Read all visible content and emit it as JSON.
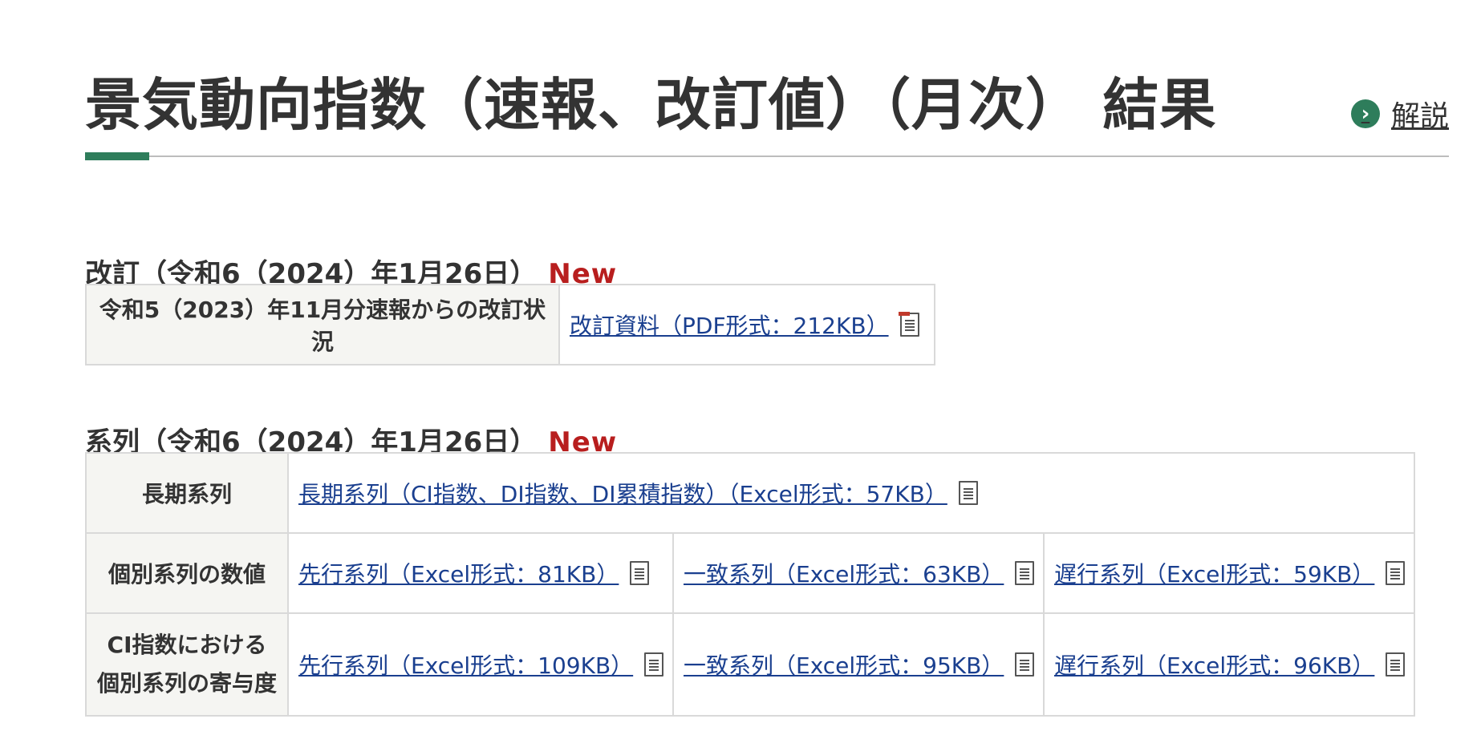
{
  "header": {
    "title": "景気動向指数（速報、改訂値）（月次） 結果",
    "explain_link": "解説",
    "colors": {
      "accent": "#2e7d5b",
      "new_badge": "#b81e1e",
      "link": "#1a3f8f"
    }
  },
  "revision_section": {
    "heading": "改訂（令和6（2024）年1月26日）",
    "new_badge": "New",
    "row_label": "令和5（2023）年11月分速報からの改訂状況",
    "link": "改訂資料（PDF形式：212KB）",
    "link_icon": "pdf-document-icon"
  },
  "series_section": {
    "heading": "系列（令和6（2024）年1月26日）",
    "new_badge": "New",
    "rows": [
      {
        "label": "長期系列",
        "links": [
          "長期系列（CI指数、DI指数、DI累積指数）（Excel形式：57KB）"
        ]
      },
      {
        "label": "個別系列の数値",
        "links": [
          "先行系列（Excel形式：81KB）",
          "一致系列（Excel形式：63KB）",
          "遅行系列（Excel形式：59KB）"
        ]
      },
      {
        "label_line1": "CI指数における",
        "label_line2": "個別系列の寄与度",
        "links": [
          "先行系列（Excel形式：109KB）",
          "一致系列（Excel形式：95KB）",
          "遅行系列（Excel形式：96KB）"
        ]
      }
    ],
    "link_icon": "excel-document-icon"
  }
}
